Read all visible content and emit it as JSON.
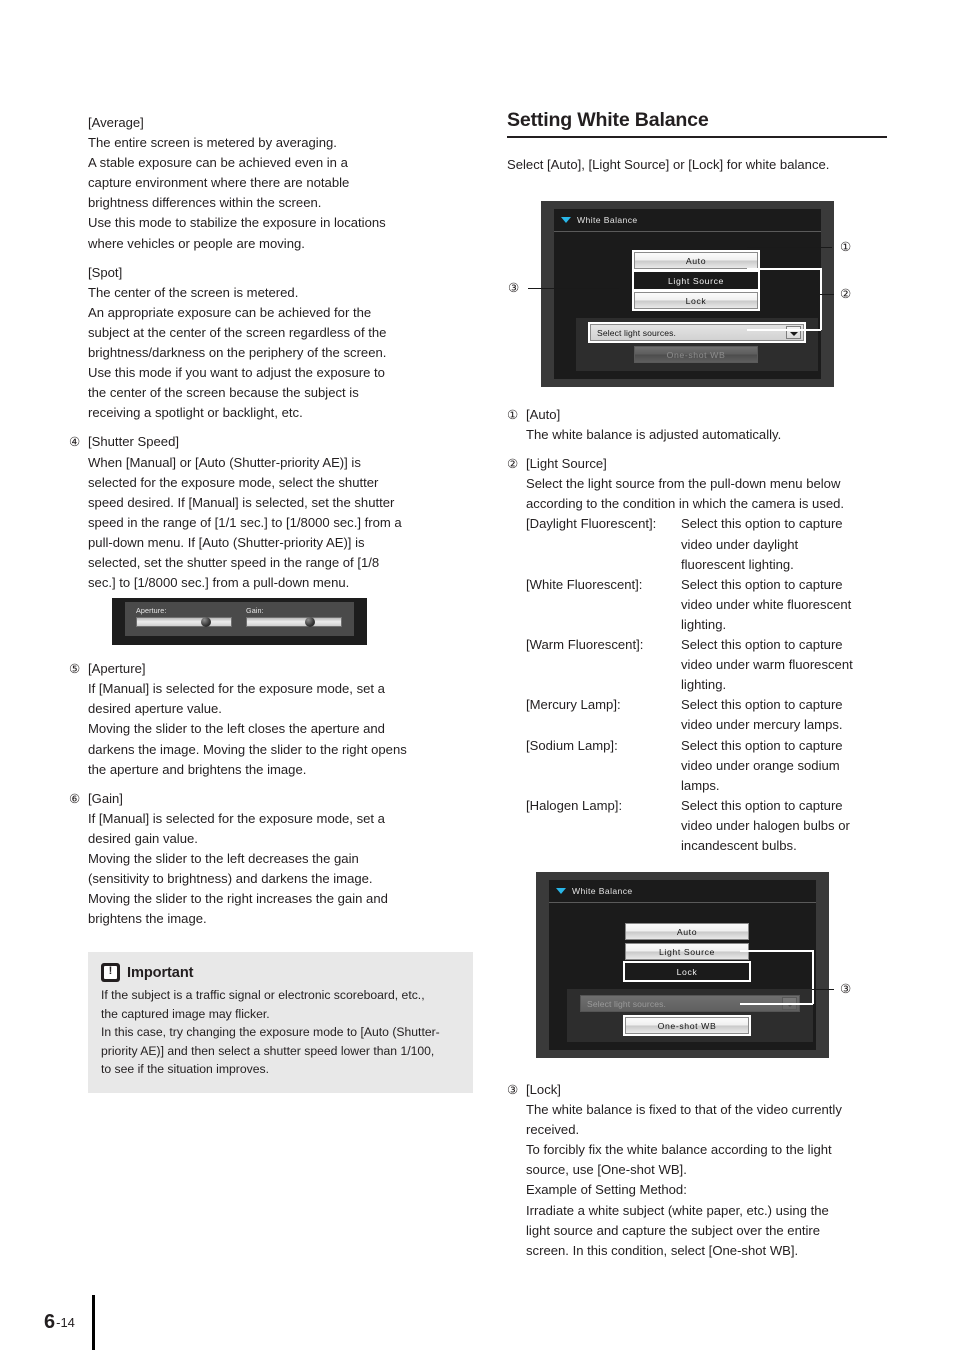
{
  "left_column": {
    "average": {
      "label": "[Average]",
      "lines": [
        "The entire screen is metered by averaging.",
        "A stable exposure can be achieved even in a",
        "capture environment where there are notable",
        "brightness differences within the screen.",
        "Use this mode to stabilize the exposure in locations",
        "where vehicles or people are moving."
      ]
    },
    "spot": {
      "label": "[Spot]",
      "lines": [
        "The center of the screen is metered.",
        "An appropriate exposure can be achieved for the",
        "subject at the center of the screen regardless of the",
        "brightness/darkness on the periphery of the screen.",
        "Use this mode if you want to adjust the exposure to",
        "the center of the screen because the subject is",
        "receiving a spotlight or backlight, etc."
      ]
    },
    "shutter_speed": {
      "marker": "④",
      "label": "[Shutter Speed]",
      "lines": [
        "When [Manual] or [Auto (Shutter-priority AE)] is",
        "selected for the exposure mode, select the shutter",
        "speed desired. If [Manual] is selected, set the shutter",
        "speed in the range of [1/1 sec.] to [1/8000 sec.] from a",
        "pull-down menu. If [Auto (Shutter-priority AE)] is",
        "selected, set the shutter speed in the range of [1/8",
        "sec.] to [1/8000 sec.] from a pull-down menu."
      ]
    },
    "aperture": {
      "marker": "⑤",
      "label": "[Aperture]",
      "lines": [
        "If [Manual] is selected for the exposure mode, set a",
        "desired aperture value.",
        "Moving the slider to the left closes the aperture and",
        "darkens the image. Moving the slider to the right opens",
        "the aperture and brightens the image."
      ]
    },
    "gain": {
      "marker": "⑥",
      "label": "[Gain]",
      "lines": [
        "If [Manual] is selected for the exposure mode, set a",
        "desired gain value.",
        "Moving the slider to the left decreases the gain",
        "(sensitivity to brightness) and darkens the image.",
        "Moving the slider to the right increases the gain and",
        "brightens the image."
      ]
    },
    "important": {
      "title": "Important",
      "icon": "important-book-icon",
      "lines": [
        "If the subject is a traffic signal or electronic scoreboard, etc.,",
        "the captured image may flicker.",
        "In this case, try changing the exposure mode to [Auto (Shutter-",
        "priority AE)] and then select a shutter speed lower than 1/100,",
        "to see if the situation improves."
      ]
    }
  },
  "aperture_gain_widget": {
    "aperture_label": "Aperture:",
    "gain_label": "Gain:",
    "aperture_value_pct": 72,
    "gain_value_pct": 66
  },
  "right_column": {
    "heading": "Setting White Balance",
    "intro": "Select [Auto], [Light Source] or [Lock] for white balance.",
    "dialog1": {
      "title": "White Balance",
      "buttons": [
        {
          "label": "Auto",
          "state": "normal"
        },
        {
          "label": "Light Source",
          "state": "selected"
        },
        {
          "label": "Lock",
          "state": "normal"
        }
      ],
      "dropdown": {
        "value": "Select light sources.",
        "enabled": true
      },
      "oneshot": {
        "label": "One-shot WB",
        "enabled": false
      },
      "callouts": [
        "①",
        "②",
        "③"
      ]
    },
    "dialog2": {
      "title": "White Balance",
      "buttons": [
        {
          "label": "Auto",
          "state": "normal"
        },
        {
          "label": "Light Source",
          "state": "normal"
        },
        {
          "label": "Lock",
          "state": "selected"
        }
      ],
      "dropdown": {
        "value": "Select light sources.",
        "enabled": false
      },
      "oneshot": {
        "label": "One-shot WB",
        "enabled": true
      },
      "callouts": [
        "③"
      ]
    },
    "auto": {
      "marker": "①",
      "label": "[Auto]",
      "lines": [
        "The white balance is adjusted automatically."
      ]
    },
    "light_source": {
      "marker": "②",
      "label": "[Light Source]",
      "lines": [
        "Select the light source from the pull-down menu below",
        "according to the condition in which the camera is used."
      ],
      "options": [
        {
          "term": "[Daylight Fluorescent]:",
          "desc": [
            "Select this option to capture",
            "video under daylight",
            "fluorescent lighting."
          ]
        },
        {
          "term": "[White Fluorescent]:",
          "desc": [
            "Select this option to capture",
            "video under white fluorescent",
            "lighting."
          ]
        },
        {
          "term": "[Warm Fluorescent]:",
          "desc": [
            "Select this option to capture",
            "video under warm fluorescent",
            "lighting."
          ]
        },
        {
          "term": "[Mercury Lamp]:",
          "desc": [
            "Select this option to capture",
            "video under mercury lamps."
          ]
        },
        {
          "term": "[Sodium Lamp]:",
          "desc": [
            "Select this option to capture",
            "video under orange sodium",
            "lamps."
          ]
        },
        {
          "term": "[Halogen Lamp]:",
          "desc": [
            "Select this option to capture",
            "video under halogen bulbs or",
            "incandescent bulbs."
          ]
        }
      ]
    },
    "lock": {
      "marker": "③",
      "label": "[Lock]",
      "lines": [
        "The white balance is fixed to that of the video currently",
        "received.",
        "To forcibly fix the white balance according to the light",
        "source, use [One-shot WB].",
        "Example of Setting Method:",
        "Irradiate a white subject (white paper, etc.) using the",
        "light source and capture the subject over the entire",
        "screen. In this condition, select [One-shot WB]."
      ]
    }
  },
  "footer": {
    "chapter": "6",
    "page": "-14"
  }
}
